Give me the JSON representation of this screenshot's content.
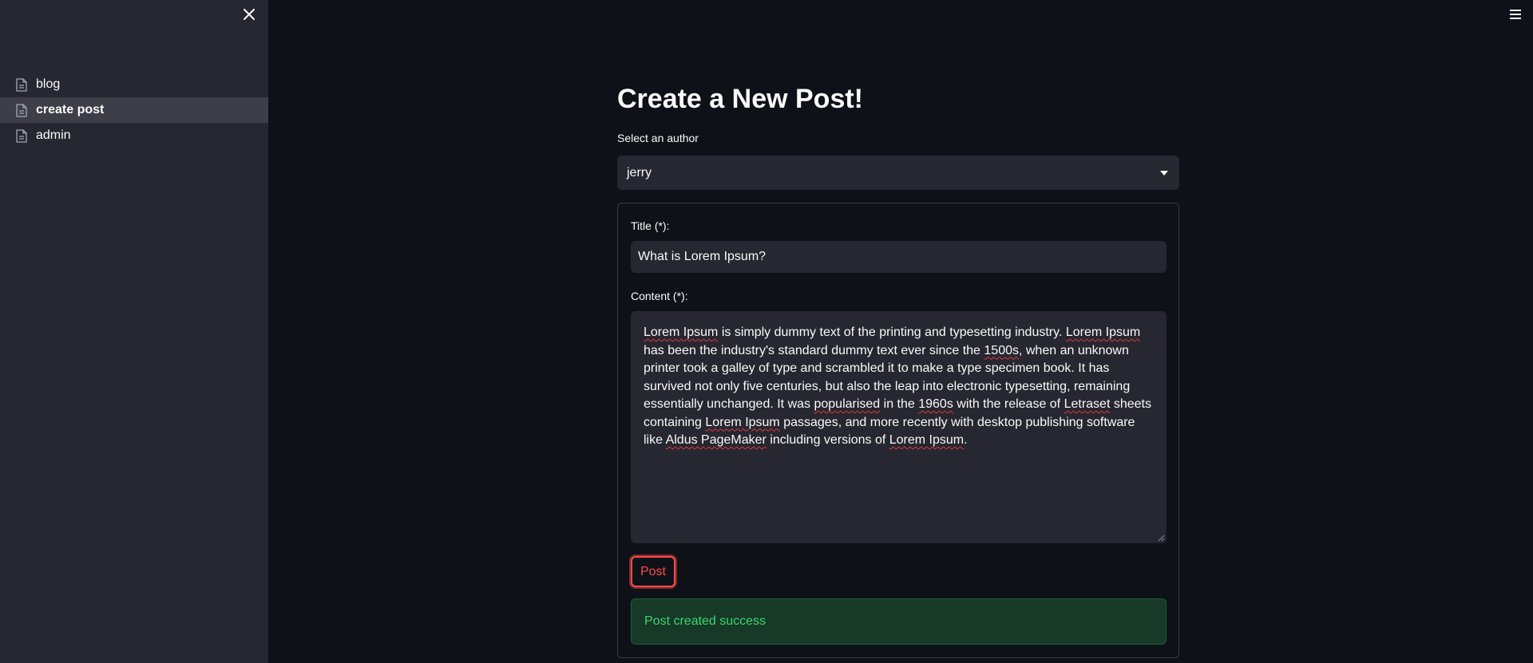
{
  "sidebar": {
    "close_icon": "close-icon",
    "items": [
      {
        "label": "blog",
        "icon": "document-icon",
        "active": false
      },
      {
        "label": "create post",
        "icon": "document-icon",
        "active": true
      },
      {
        "label": "admin",
        "icon": "document-icon",
        "active": false
      }
    ]
  },
  "header": {
    "menu_icon": "hamburger-menu-icon"
  },
  "main": {
    "title": "Create a New Post!",
    "author_label": "Select an author",
    "author_value": "jerry",
    "form": {
      "title_label": "Title (*):",
      "title_value": "What is Lorem Ipsum?",
      "content_label": "Content (*):",
      "content_segments": [
        {
          "text": "Lorem Ipsum",
          "spell": true
        },
        {
          "text": " is simply dummy text of the printing and typesetting industry. ",
          "spell": false
        },
        {
          "text": "Lorem Ipsum",
          "spell": true
        },
        {
          "text": " has been the industry's standard dummy text ever since the ",
          "spell": false
        },
        {
          "text": "1500s",
          "spell": true
        },
        {
          "text": ", when an unknown printer took a galley of type and scrambled it to make a type specimen book. It has survived not only five centuries, but also the leap into electronic typesetting, remaining essentially unchanged. It was ",
          "spell": false
        },
        {
          "text": "popularised",
          "spell": true
        },
        {
          "text": " in the ",
          "spell": false
        },
        {
          "text": "1960s",
          "spell": true
        },
        {
          "text": " with the release of ",
          "spell": false
        },
        {
          "text": "Letraset",
          "spell": true
        },
        {
          "text": " sheets containing ",
          "spell": false
        },
        {
          "text": "Lorem Ipsum",
          "spell": true
        },
        {
          "text": " passages, and more recently with desktop publishing software like ",
          "spell": false
        },
        {
          "text": "Aldus PageMaker",
          "spell": true
        },
        {
          "text": " including versions of ",
          "spell": false
        },
        {
          "text": "Lorem Ipsum",
          "spell": true
        },
        {
          "text": ".",
          "spell": false
        }
      ],
      "post_label": "Post",
      "success_message": "Post created success"
    }
  },
  "colors": {
    "background": "#0e1117",
    "sidebar": "#262730",
    "accent": "#ff4b4b",
    "success_text": "#3dd56d",
    "success_bg": "#173928"
  }
}
